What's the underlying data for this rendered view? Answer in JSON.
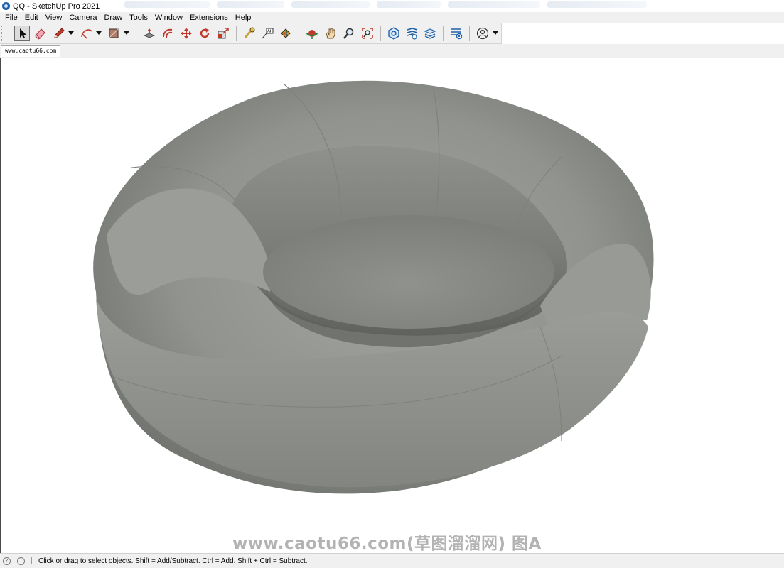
{
  "window": {
    "title": "QQ - SketchUp Pro 2021"
  },
  "menu": {
    "items": [
      "File",
      "Edit",
      "View",
      "Camera",
      "Draw",
      "Tools",
      "Window",
      "Extensions",
      "Help"
    ]
  },
  "toolbar": {
    "tools": [
      {
        "name": "select-icon",
        "active": true
      },
      {
        "name": "eraser-icon"
      },
      {
        "name": "pencil-line-icon",
        "dropdown": true
      },
      {
        "name": "arc-icon",
        "dropdown": true
      },
      {
        "name": "rectangle-icon",
        "dropdown": true
      },
      {
        "name": "push-pull-icon"
      },
      {
        "name": "offset-icon"
      },
      {
        "name": "move-icon"
      },
      {
        "name": "rotate-icon"
      },
      {
        "name": "scale-icon"
      },
      {
        "name": "tape-measure-icon"
      },
      {
        "name": "text-icon"
      },
      {
        "name": "paint-bucket-icon"
      },
      {
        "name": "orbit-icon"
      },
      {
        "name": "pan-icon"
      },
      {
        "name": "zoom-icon"
      },
      {
        "name": "zoom-extents-icon"
      },
      {
        "name": "warehouse-icon"
      },
      {
        "name": "extension-warehouse-icon"
      },
      {
        "name": "layout-icon"
      },
      {
        "name": "extension-manager-icon"
      },
      {
        "name": "account-icon",
        "dropdown": true
      }
    ]
  },
  "scene_tab": {
    "label": "www.caotu66.com"
  },
  "viewport": {
    "watermark": "www.caotu66.com(草图溜溜网) 图A",
    "model_color": "#8e918c"
  },
  "status": {
    "text": "Click or drag to select objects. Shift = Add/Subtract. Ctrl = Add. Shift + Ctrl = Subtract."
  }
}
